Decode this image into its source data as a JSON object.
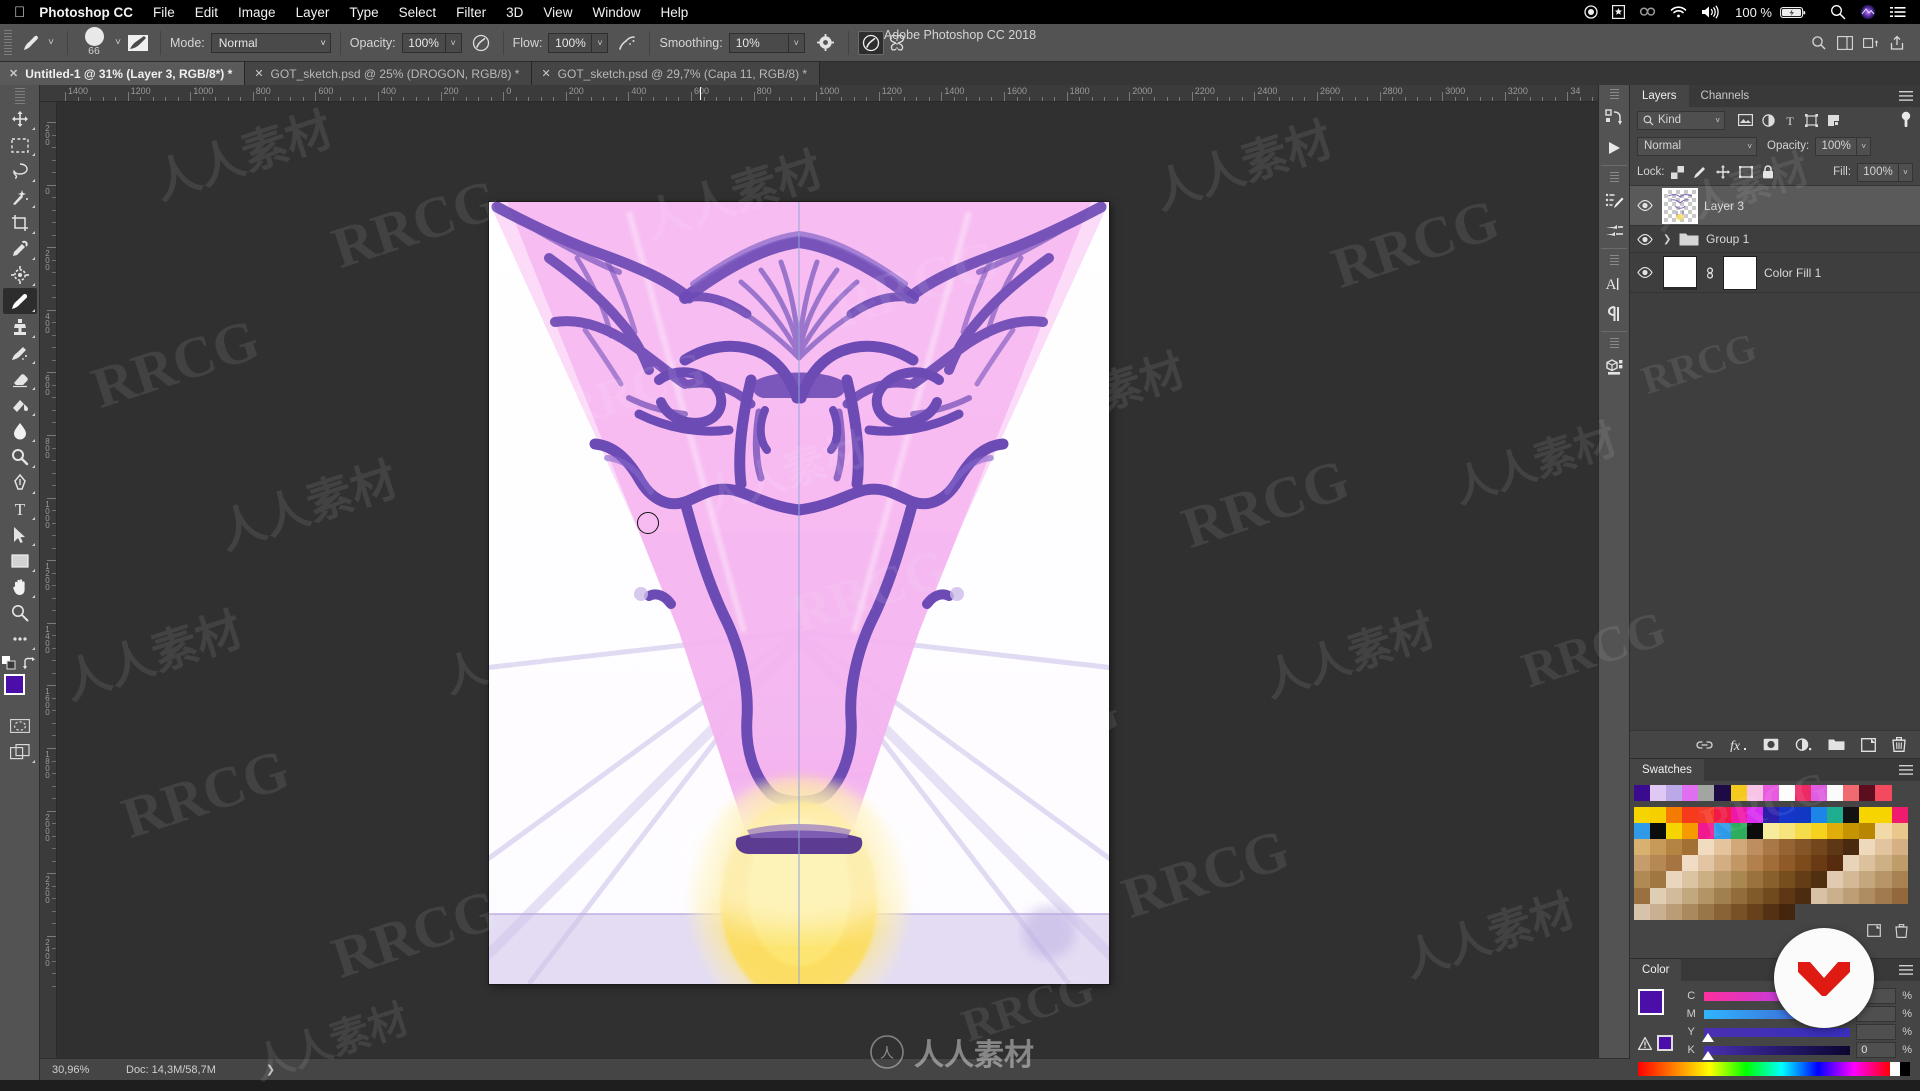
{
  "macbar": {
    "apple": "",
    "app_name": "Photoshop CC",
    "menus": [
      "File",
      "Edit",
      "Image",
      "Layer",
      "Type",
      "Select",
      "Filter",
      "3D",
      "View",
      "Window",
      "Help"
    ],
    "status_icons": [
      "record-icon",
      "bookmark-icon",
      "creative-cloud-icon",
      "wifi-icon",
      "volume-icon"
    ],
    "battery_percent": "100 %",
    "right_icons": [
      "search-icon",
      "siri-icon",
      "control-center-icon"
    ]
  },
  "window": {
    "title": "Adobe Photoshop CC 2018"
  },
  "options_bar": {
    "tool_icon": "brush-tool-icon",
    "brush_size": "66",
    "brush_preset_icon": "brush-preset-picker-icon",
    "mode_label": "Mode:",
    "mode_value": "Normal",
    "opacity_label": "Opacity:",
    "opacity_value": "100%",
    "pressure_opacity_icon": "pressure-opacity-icon",
    "flow_label": "Flow:",
    "flow_value": "100%",
    "airbrush_icon": "airbrush-icon",
    "smoothing_label": "Smoothing:",
    "smoothing_value": "10%",
    "smoothing_options_icon": "gear-icon",
    "tablet_pressure_icon": "tablet-pressure-size-icon",
    "symmetry_icon": "symmetry-butterfly-icon",
    "right_icons": [
      "search-icon",
      "workspace-icon",
      "arrange-icon",
      "share-icon"
    ]
  },
  "tabs": [
    {
      "label": "Untitled-1 @ 31% (Layer 3, RGB/8*) *",
      "active": true
    },
    {
      "label": "GOT_sketch.psd @ 25% (DROGON, RGB/8) *",
      "active": false
    },
    {
      "label": "GOT_sketch.psd @ 29,7% (Capa 11, RGB/8) *",
      "active": false
    }
  ],
  "toolbar": {
    "tools": [
      {
        "name": "move-tool",
        "selected": false
      },
      {
        "name": "rectangular-marquee-tool",
        "selected": false
      },
      {
        "name": "lasso-tool",
        "selected": false
      },
      {
        "name": "magic-wand-tool",
        "selected": false
      },
      {
        "name": "crop-tool",
        "selected": false
      },
      {
        "name": "eyedropper-tool",
        "selected": false
      },
      {
        "name": "spot-healing-brush-tool",
        "selected": false
      },
      {
        "name": "brush-tool",
        "selected": true
      },
      {
        "name": "clone-stamp-tool",
        "selected": false
      },
      {
        "name": "history-brush-tool",
        "selected": false
      },
      {
        "name": "eraser-tool",
        "selected": false
      },
      {
        "name": "gradient-tool",
        "selected": false
      },
      {
        "name": "blur-tool",
        "selected": false
      },
      {
        "name": "dodge-tool",
        "selected": false
      },
      {
        "name": "pen-tool",
        "selected": false
      },
      {
        "name": "type-tool",
        "selected": false
      },
      {
        "name": "path-selection-tool",
        "selected": false
      },
      {
        "name": "rectangle-tool",
        "selected": false
      },
      {
        "name": "hand-tool",
        "selected": false
      },
      {
        "name": "zoom-tool",
        "selected": false
      },
      {
        "name": "edit-toolbar-tool",
        "selected": false
      }
    ],
    "foreground_color": "#4b0ea8",
    "background_color": "#e95fe0",
    "quick_mask_icon": "quick-mask-icon",
    "screen_mode_icon": "screen-mode-icon",
    "swap_colors_icon": "swap-colors-icon",
    "default_colors_icon": "default-colors-icon"
  },
  "rulers": {
    "horizontal_labels": [
      "1400",
      "1200",
      "1000",
      "800",
      "600",
      "400",
      "200",
      "0",
      "200",
      "400",
      "600",
      "800",
      "1000",
      "1200",
      "1400",
      "1600",
      "1800",
      "2000",
      "2200",
      "2400",
      "2600",
      "2800",
      "3000",
      "3200",
      "34"
    ],
    "vertical_labels": [
      "200",
      "0",
      "200",
      "400",
      "600",
      "800",
      "1000",
      "1200",
      "1400",
      "1600",
      "1800",
      "2000",
      "2200",
      "2400"
    ]
  },
  "canvas": {
    "artwork_description": "dragon-head-sketch",
    "guide_color": "#8fa8d8",
    "brush_cursor": "brush-circle-cursor"
  },
  "rail_icons": [
    "libraries-icon",
    "play-icon",
    "brush-settings-icon",
    "brush-presets-icon",
    "character-panel-icon",
    "paragraph-panel-icon",
    "3d-panel-icon"
  ],
  "layers_panel": {
    "tabs": [
      {
        "label": "Layers",
        "active": true
      },
      {
        "label": "Channels",
        "active": false
      }
    ],
    "menu_icon": "panel-menu-icon",
    "filter_label": "Kind",
    "filter_icons": [
      "filter-pixel-icon",
      "filter-adjustment-icon",
      "filter-type-icon",
      "filter-shape-icon",
      "filter-smart-object-icon"
    ],
    "filter_toggle_icon": "filter-toggle-icon",
    "blend_mode": "Normal",
    "opacity_label": "Opacity:",
    "opacity_value": "100%",
    "lock_label": "Lock:",
    "lock_icons": [
      "lock-transparency-icon",
      "lock-image-icon",
      "lock-position-icon",
      "lock-artboard-icon",
      "lock-all-icon"
    ],
    "fill_label": "Fill:",
    "fill_value": "100%",
    "layers": [
      {
        "name": "Layer 3",
        "visible": true,
        "selected": true,
        "type": "pixel"
      },
      {
        "name": "Group 1",
        "visible": true,
        "selected": false,
        "type": "group"
      },
      {
        "name": "Color Fill 1",
        "visible": true,
        "selected": false,
        "type": "fill"
      }
    ],
    "footer_icons": [
      "link-layers-icon",
      "fx-icon",
      "add-mask-icon",
      "adjustment-layer-icon",
      "new-group-icon",
      "new-layer-icon",
      "delete-layer-icon"
    ]
  },
  "swatches_panel": {
    "title": "Swatches",
    "menu_icon": "panel-menu-icon",
    "footer_icons": [
      "new-swatch-icon",
      "delete-swatch-icon"
    ],
    "rows": [
      [
        "#3a0b8f",
        "#e0c8f5",
        "#bba8e6",
        "#e06ef0",
        "#a2a6a0",
        "#1d0b45",
        "#f5c91e",
        "#f7c4e6",
        "#e85ae0",
        "#fdfdfd",
        "#ec2a66",
        "#e05ce0",
        "#fbfbfb",
        "#f06a72",
        "#5c0d1e",
        "#f34a5f"
      ],
      [
        "#f5d400",
        "#f5cf00",
        "#f57a00",
        "#f53b1a",
        "#f53b2a",
        "#f01a45",
        "#ef17a6",
        "#d92df0",
        "#2a1fa8",
        "#1536c9",
        "#1237c4",
        "#1e85e8",
        "#1fae8f",
        "#121212",
        "#f5d400",
        "#f5d400"
      ],
      [
        "#f01a6e",
        "#2e9ae8",
        "#0c0c0c",
        "#f5d400",
        "#f59a00",
        "#f01a8e",
        "#2e9ae8",
        "#2eae5c",
        "#0c0c0c",
        "#f7eb9e",
        "#f7e47c",
        "#f5dc4a",
        "#f5d21e",
        "#e0ad0b",
        "#c69400",
        "#b88600"
      ],
      [
        "#f2d9a8",
        "#e8c88c",
        "#d8b070",
        "#c79a58",
        "#b58442",
        "#a37033",
        "#f2dcc0",
        "#e3c49c",
        "#d0a87a",
        "#bd8e5e",
        "#a97846",
        "#966434",
        "#845526",
        "#73471c",
        "#5e3714",
        "#4a2a0e"
      ],
      [
        "#efd9bd",
        "#e2c49f",
        "#d4b084",
        "#c59c6b",
        "#b58854",
        "#a57440",
        "#f0dcc4",
        "#e2c6a4",
        "#d2ae82",
        "#c29665",
        "#b1804c",
        "#a06c38",
        "#8f5a28",
        "#7d4a1c",
        "#6a3a14",
        "#572c0e"
      ],
      [
        "#e8d4b8",
        "#dbc29c",
        "#cdb083",
        "#bf9d6b",
        "#b08a55",
        "#a17741",
        "#e9d6bd",
        "#dbc4a2",
        "#cbb084",
        "#bb9b69",
        "#aa8651",
        "#99723d",
        "#88602c",
        "#764e1e",
        "#633d15",
        "#50300f"
      ],
      [
        "#e0cbb0",
        "#d3b996",
        "#c5a77e",
        "#b79568",
        "#a88253",
        "#9a7040",
        "#dfcdb4",
        "#d1bb9a",
        "#c2a87f",
        "#b29465",
        "#a2804d",
        "#926c3a",
        "#815a2a",
        "#70491d",
        "#5e3814",
        "#4c2b0e"
      ],
      [
        "#d8c2a6",
        "#cbb08d",
        "#bd9e76",
        "#af8c61",
        "#a17a4d",
        "#93683b",
        "#d7c3aa",
        "#c9b090",
        "#ba9d76",
        "#aa895e",
        "#997547",
        "#896236",
        "#785127",
        "#67411b",
        "#553113",
        "#44260d"
      ]
    ]
  },
  "color_panel": {
    "title": "Color",
    "menu_icon": "panel-menu-icon",
    "mode": "CMYK",
    "channels": [
      {
        "label": "C",
        "value": ""
      },
      {
        "label": "M",
        "value": ""
      },
      {
        "label": "Y",
        "value": ""
      },
      {
        "label": "K",
        "value": "0"
      }
    ],
    "percent_symbol": "%",
    "foreground_color": "#4b0ea8",
    "background_color": "#e95fe0",
    "out_of_gamut_icon": "gamut-warning-icon"
  },
  "status_bar": {
    "zoom": "30,96%",
    "doc_info": "Doc: 14,3M/58,7M",
    "expand_icon": "chevron-right-icon"
  },
  "watermarks": {
    "latin": "RRCG",
    "chinese": "人人素材"
  }
}
